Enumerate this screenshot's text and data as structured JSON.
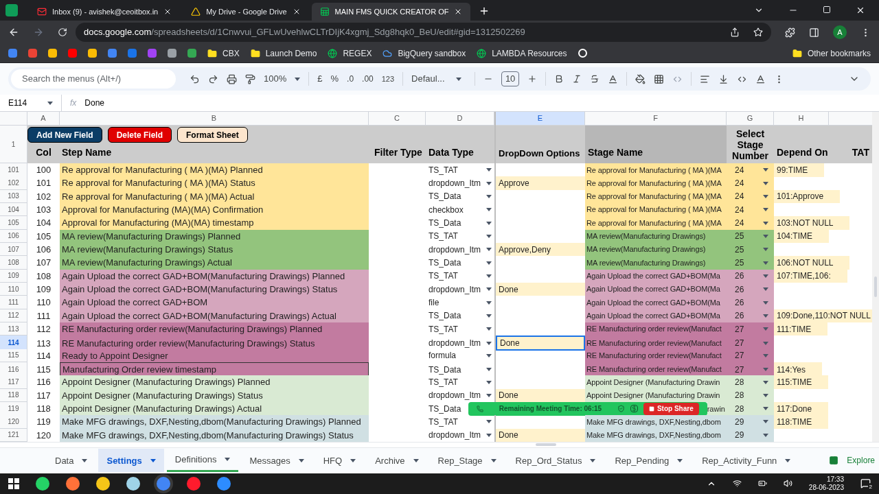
{
  "browser": {
    "tabs": [
      {
        "title": "Inbox (9) - avishek@ceoitbox.in",
        "kind": "mail",
        "selected": false
      },
      {
        "title": "My Drive - Google Drive",
        "kind": "drive",
        "selected": false
      },
      {
        "title": "MAIN FMS QUICK CREATOR OF",
        "kind": "sheets",
        "selected": true
      }
    ],
    "url_host": "docs.google.com",
    "url_path": "/spreadsheets/d/1Cnwvui_GFLwUvehlwCLTrDIjK4xgmj_Sdg8hqk0_BeU/edit#gid=1312502269",
    "profile": "A",
    "bookmarks": [
      {
        "label": "CBX",
        "kind": "folder"
      },
      {
        "label": "Launch Demo",
        "kind": "folder"
      },
      {
        "label": "REGEX",
        "kind": "site"
      },
      {
        "label": "BigQuery sandbox",
        "kind": "cloud"
      },
      {
        "label": "LAMBDA Resources",
        "kind": "site"
      }
    ],
    "other_bookmarks": "Other bookmarks"
  },
  "toolbar": {
    "search_placeholder": "Search the menus (Alt+/)",
    "zoom": "100%",
    "currency": "£",
    "percent": "%",
    "decrease_decimals": ".0",
    "increase_decimals": ".00",
    "number_format": "123",
    "font": "Defaul...",
    "font_size": "10"
  },
  "formula_bar": {
    "cell": "E114",
    "fx_label": "fx",
    "value": "Done"
  },
  "columns": [
    "A",
    "B",
    "C",
    "D",
    "E",
    "F",
    "G",
    "H"
  ],
  "header_row": {
    "number": "1",
    "buttons": [
      {
        "label": "Add New Field",
        "color": "#0b3d66"
      },
      {
        "label": "Delete Field",
        "color": "#e00000"
      },
      {
        "label": "Format Sheet",
        "color": "#fce5cd"
      }
    ],
    "col": "Col",
    "step_name": "Step Name",
    "filter_type": "Filter Type",
    "data_type": "Data Type",
    "dropdown_options": "DropDown Options",
    "stage_name": "Stage Name",
    "stage_number": "Select Stage Number",
    "depend_on": "Depend On",
    "tat": "TAT"
  },
  "rows": [
    {
      "number": "101",
      "col": "100",
      "step": "Re approval for Manufacturing ( MA )(MA) Planned",
      "data_type": "TS_TAT",
      "options": "",
      "stage": "Re approval for Manufacturing ( MA )(MA",
      "stage_number": "24",
      "depend_on": "99:TIME",
      "color": "#ffe599",
      "selected": false
    },
    {
      "number": "102",
      "col": "101",
      "step": "Re approval for Manufacturing ( MA )(MA) Status",
      "data_type": "dropdown_Itm",
      "options": "Approve",
      "stage": "Re approval for Manufacturing ( MA )(MA",
      "stage_number": "24",
      "depend_on": "",
      "color": "#ffe599",
      "selected": false
    },
    {
      "number": "103",
      "col": "102",
      "step": "Re approval for Manufacturing ( MA )(MA) Actual",
      "data_type": "TS_Data",
      "options": "",
      "stage": "Re approval for Manufacturing ( MA )(MA",
      "stage_number": "24",
      "depend_on": "101:Approve",
      "color": "#ffe599",
      "selected": false
    },
    {
      "number": "104",
      "col": "103",
      "step": "Approval for Manufacturing (MA)(MA) Confirmation",
      "data_type": "checkbox",
      "options": "",
      "stage": "Re approval for Manufacturing ( MA )(MA",
      "stage_number": "24",
      "depend_on": "",
      "color": "#ffe599",
      "selected": false
    },
    {
      "number": "105",
      "col": "104",
      "step": "Approval for Manufacturing (MA)(MA) timestamp",
      "data_type": "TS_Data",
      "options": "",
      "stage": "Re approval for Manufacturing ( MA )(MA",
      "stage_number": "24",
      "depend_on": "103:NOT NULL",
      "color": "#ffe599",
      "selected": false
    },
    {
      "number": "106",
      "col": "105",
      "step": "MA review(Manufacturing Drawings) Planned",
      "data_type": "TS_TAT",
      "options": "",
      "stage": "MA review(Manufacturing Drawings)",
      "stage_number": "25",
      "depend_on": "104:TIME",
      "color": "#93c47d",
      "selected": false
    },
    {
      "number": "107",
      "col": "106",
      "step": "MA review(Manufacturing Drawings) Status",
      "data_type": "dropdown_Itm",
      "options": "Approve,Deny",
      "stage": "MA review(Manufacturing Drawings)",
      "stage_number": "25",
      "depend_on": "",
      "color": "#93c47d",
      "selected": false
    },
    {
      "number": "108",
      "col": "107",
      "step": "MA review(Manufacturing Drawings) Actual",
      "data_type": "TS_Data",
      "options": "",
      "stage": "MA review(Manufacturing Drawings)",
      "stage_number": "25",
      "depend_on": "106:NOT NULL",
      "color": "#93c47d",
      "selected": false
    },
    {
      "number": "109",
      "col": "108",
      "step": "Again Upload the correct GAD+BOM(Manufacturing Drawings) Planned",
      "data_type": "TS_TAT",
      "options": "",
      "stage": "Again Upload the correct GAD+BOM(Ma",
      "stage_number": "26",
      "depend_on": "107:TIME,106:",
      "color": "#d5a6bd",
      "selected": false
    },
    {
      "number": "110",
      "col": "109",
      "step": "Again Upload the correct GAD+BOM(Manufacturing Drawings) Status",
      "data_type": "dropdown_Itm",
      "options": "Done",
      "stage": "Again Upload the correct GAD+BOM(Ma",
      "stage_number": "26",
      "depend_on": "",
      "color": "#d5a6bd",
      "selected": false
    },
    {
      "number": "111",
      "col": "110",
      "step": "Again Upload the correct GAD+BOM",
      "data_type": "file",
      "options": "",
      "stage": "Again Upload the correct GAD+BOM(Ma",
      "stage_number": "26",
      "depend_on": "",
      "color": "#d5a6bd",
      "selected": false
    },
    {
      "number": "112",
      "col": "111",
      "step": "Again Upload the correct GAD+BOM(Manufacturing Drawings) Actual",
      "data_type": "TS_Data",
      "options": "",
      "stage": "Again Upload the correct GAD+BOM(Ma",
      "stage_number": "26",
      "depend_on": "109:Done,110:NOT NULL",
      "color": "#d5a6bd",
      "selected": false
    },
    {
      "number": "113",
      "col": "112",
      "step": "RE Manufacturing order review(Manufacturing Drawings) Planned",
      "data_type": "TS_TAT",
      "options": "",
      "stage": "RE Manufacturing order review(Manufact",
      "stage_number": "27",
      "depend_on": "111:TIME",
      "color": "#c27ba0",
      "selected": false
    },
    {
      "number": "114",
      "col": "113",
      "step": "RE Manufacturing order review(Manufacturing Drawings) Status",
      "data_type": "dropdown_Itm",
      "options": "Done",
      "stage": "RE Manufacturing order review(Manufact",
      "stage_number": "27",
      "depend_on": "",
      "color": "#c27ba0",
      "selected": true
    },
    {
      "number": "115",
      "col": "114",
      "step": "Ready to Appoint Designer",
      "data_type": "formula",
      "options": "",
      "stage": "RE Manufacturing order review(Manufact",
      "stage_number": "27",
      "depend_on": "",
      "color": "#c27ba0",
      "selected": false
    },
    {
      "number": "116",
      "col": "115",
      "step": "Manufacturing Order review timestamp",
      "data_type": "TS_Data",
      "options": "",
      "stage": "RE Manufacturing order review(Manufact",
      "stage_number": "27",
      "depend_on": "114:Yes",
      "color": "#c27ba0",
      "selected": false,
      "outlined": true
    },
    {
      "number": "117",
      "col": "116",
      "step": "Appoint Designer (Manufacturing Drawings) Planned",
      "data_type": "TS_TAT",
      "options": "",
      "stage": "Appoint Designer (Manufacturing Drawin",
      "stage_number": "28",
      "depend_on": "115:TIME",
      "color": "#d9ead3",
      "selected": false
    },
    {
      "number": "118",
      "col": "117",
      "step": "Appoint Designer (Manufacturing Drawings) Status",
      "data_type": "dropdown_Itm",
      "options": "Done",
      "stage": "Appoint Designer (Manufacturing Drawin",
      "stage_number": "28",
      "depend_on": "",
      "color": "#d9ead3",
      "selected": false
    },
    {
      "number": "119",
      "col": "118",
      "step": "Appoint Designer (Manufacturing Drawings) Actual",
      "data_type": "TS_Data",
      "options": "",
      "stage": "rawin",
      "stage_number": "28",
      "depend_on": "117:Done",
      "color": "#d9ead3",
      "selected": false,
      "meeting_bar": {
        "text": "Remaining Meeting Time: 06:15",
        "stop": "Stop Share"
      }
    },
    {
      "number": "120",
      "col": "119",
      "step": "Make MFG drawings, DXF,Nesting,dbom(Manufacturing Drawings) Planned",
      "data_type": "TS_TAT",
      "options": "",
      "stage": "Make MFG drawings, DXF,Nesting,dbom",
      "stage_number": "29",
      "depend_on": "118:TIME",
      "color": "#d0e0e3",
      "selected": false
    },
    {
      "number": "121",
      "col": "120",
      "step": "Make MFG drawings, DXF,Nesting,dbom(Manufacturing Drawings) Status",
      "data_type": "dropdown_Itm",
      "options": "Done",
      "stage": "Make MFG drawings, DXF,Nesting,dbom",
      "stage_number": "29",
      "depend_on": "",
      "color": "#d0e0e3",
      "selected": false
    }
  ],
  "sheet_tabs": [
    {
      "label": "Data",
      "selected": false
    },
    {
      "label": "Settings",
      "selected": true
    },
    {
      "label": "Definitions",
      "selected": false,
      "color": "#34a853"
    },
    {
      "label": "Messages",
      "selected": false
    },
    {
      "label": "HFQ",
      "selected": false
    },
    {
      "label": "Archive",
      "selected": false
    },
    {
      "label": "Rep_Stage",
      "selected": false
    },
    {
      "label": "Rep_Ord_Status",
      "selected": false
    },
    {
      "label": "Rep_Pending",
      "selected": false
    },
    {
      "label": "Rep_Activity_Funn",
      "selected": false
    }
  ],
  "explore": "Explore",
  "taskbar": {
    "time": "17:33",
    "date": "28-06-2023",
    "notifications": "2"
  }
}
